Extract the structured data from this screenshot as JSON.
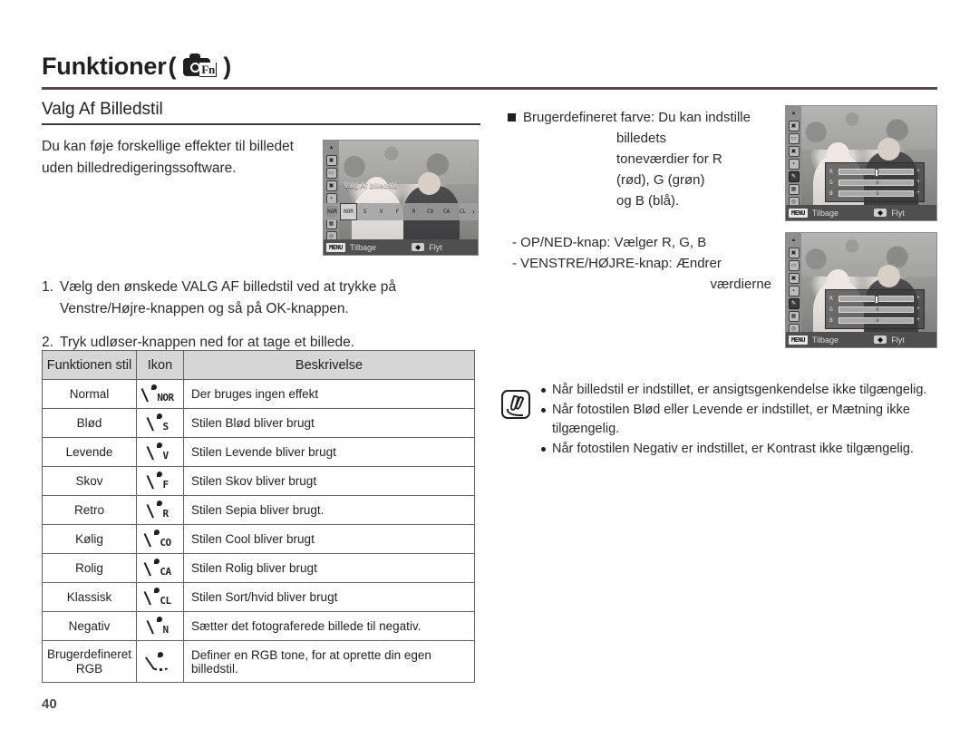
{
  "header": {
    "chapter_title": "Funktioner",
    "paren_open": "(",
    "paren_close": ")",
    "icon_name": "camera-fn-icon",
    "fn_label": "Fn"
  },
  "section": {
    "heading": "Valg Af Billedstil"
  },
  "intro": {
    "text": "Du kan føje forskellige effekter til billedet uden billedredigeringssoftware."
  },
  "steps": [
    {
      "num": "1.",
      "text": "Vælg den ønskede VALG AF billedstil ved at trykke på Venstre/Højre-knappen og så på OK-knappen."
    },
    {
      "num": "2.",
      "text": "Tryk udløser-knappen ned for at tage et billede."
    }
  ],
  "table": {
    "headers": [
      "Funktionen stil",
      "Ikon",
      "Beskrivelse"
    ],
    "rows": [
      {
        "style": "Normal",
        "icon": "NOR",
        "desc": "Der bruges ingen effekt"
      },
      {
        "style": "Blød",
        "icon": "S",
        "desc": "Stilen Blød bliver brugt"
      },
      {
        "style": "Levende",
        "icon": "V",
        "desc": "Stilen Levende bliver brugt"
      },
      {
        "style": "Skov",
        "icon": "F",
        "desc": "Stilen Skov bliver brugt"
      },
      {
        "style": "Retro",
        "icon": "R",
        "desc": "Stilen Sepia bliver brugt."
      },
      {
        "style": "Kølig",
        "icon": "CO",
        "desc": "Stilen Cool bliver brugt"
      },
      {
        "style": "Rolig",
        "icon": "CA",
        "desc": "Stilen Rolig bliver brugt"
      },
      {
        "style": "Klassisk",
        "icon": "CL",
        "desc": "Stilen Sort/hvid bliver brugt"
      },
      {
        "style": "Negativ",
        "icon": "N",
        "desc": "Sætter det fotograferede billede til negativ."
      },
      {
        "style": "Brugerdefineret RGB",
        "icon": "RGB",
        "desc": "Definer en RGB tone, for at oprette din egen billedstil."
      }
    ]
  },
  "right_column": {
    "bullet": {
      "lead": "Brugerdefineret farve: Du kan indstille",
      "cont": [
        "billedets",
        "toneværdier for R",
        "(rød), G (grøn)",
        "og B (blå)."
      ]
    },
    "keys": [
      "- OP/NED-knap: Vælger R, G, B",
      "- VENSTRE/HØJRE-knap: Ændrer",
      "værdierne"
    ]
  },
  "notes": {
    "icon_name": "pen-note-icon",
    "items": [
      "Når billedstil er indstillet, er ansigtsgenkendelse ikke tilgængelig.",
      "Når fotostilen Blød eller Levende er indstillet, er Mætning ikke tilgængelig.",
      "Når fotostilen Negativ er indstillet, er Kontrast ikke tilgængelig."
    ]
  },
  "lcd_left": {
    "menu_label": "Valg Af billedstil",
    "style_icons": [
      "NOR",
      "NOR",
      "S",
      "V",
      "F",
      "R",
      "CO",
      "CA",
      "CL"
    ],
    "arrow": "›",
    "menu_key": "MENU",
    "back_label": "Tilbage",
    "move_key": "◆",
    "move_label": "Flyt"
  },
  "lcd_right_top": {
    "menu_key": "MENU",
    "back_label": "Tilbage",
    "move_key": "◆",
    "move_label": "Flyt",
    "rgb_rows": [
      {
        "label": "R",
        "value": "0",
        "pos": 50
      },
      {
        "label": "G",
        "value": "0",
        "pos": 50
      },
      {
        "label": "B",
        "value": "0",
        "pos": 50
      }
    ]
  },
  "lcd_right_bottom": {
    "menu_key": "MENU",
    "back_label": "Tilbage",
    "move_key": "◆",
    "move_label": "Flyt",
    "rgb_rows": [
      {
        "label": "R",
        "value": "0",
        "pos": 50
      },
      {
        "label": "G",
        "value": "0",
        "pos": 50
      },
      {
        "label": "B",
        "value": "0",
        "pos": 50
      }
    ]
  },
  "footer": {
    "page_number": "40"
  },
  "colors": {
    "rule": "#5b4a55",
    "table_header_bg": "#d6d6d6",
    "table_border": "#6b5b66",
    "text": "#2b2b2b"
  }
}
